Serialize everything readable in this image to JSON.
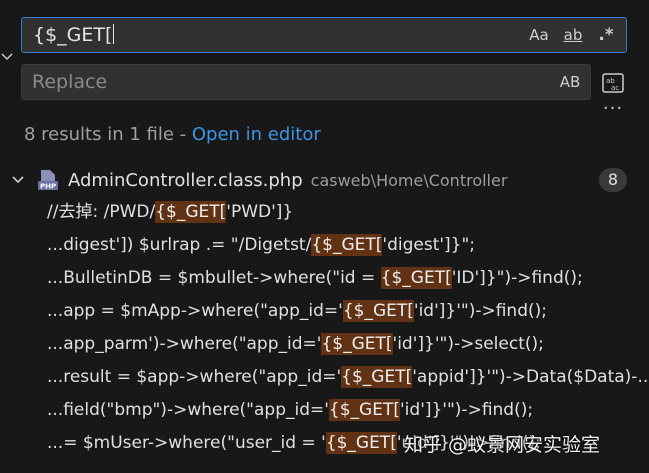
{
  "find": {
    "value": "{$_GET[",
    "match_case": "Aa",
    "match_word": "ab",
    "regex": ".*"
  },
  "replace": {
    "placeholder": "Replace",
    "preserve_case": "AB"
  },
  "summary": {
    "text": "8 results in 1 file - ",
    "link": "Open in editor"
  },
  "file": {
    "name": "AdminController.class.php",
    "path": "casweb\\Home\\Controller",
    "count": "8"
  },
  "matches": [
    {
      "before": "//去掉: /PWD/",
      "hit": "{$_GET[",
      "after": "'PWD']}"
    },
    {
      "before": "...digest']) $urlrap .= \"/Digetst/",
      "hit": "{$_GET[",
      "after": "'digest']}\";"
    },
    {
      "before": "...BulletinDB = $mbullet->where(\"id = ",
      "hit": "{$_GET[",
      "after": "'ID']}\")->find();"
    },
    {
      "before": "...app = $mApp->where(\"app_id='",
      "hit": "{$_GET[",
      "after": "'id']}'\")->find();"
    },
    {
      "before": "...app_parm')->where(\"app_id='",
      "hit": "{$_GET[",
      "after": "'id']}'\")->select();"
    },
    {
      "before": "...result = $app->where(\"app_id='",
      "hit": "{$_GET[",
      "after": "'appid']}'\")->Data($Data)-..."
    },
    {
      "before": "...field(\"bmp\")->where(\"app_id='",
      "hit": "{$_GET[",
      "after": "'id']}'\")->find();"
    },
    {
      "before": "...= $mUser->where(\"user_id = '",
      "hit": "{$_GET[",
      "after": "'uid']}'\")->find();"
    }
  ],
  "watermark": "知乎 @蚁景网安实验室",
  "colors": {
    "accent": "#2f7fd1",
    "link": "#3d95e6",
    "highlight": "#613214"
  }
}
